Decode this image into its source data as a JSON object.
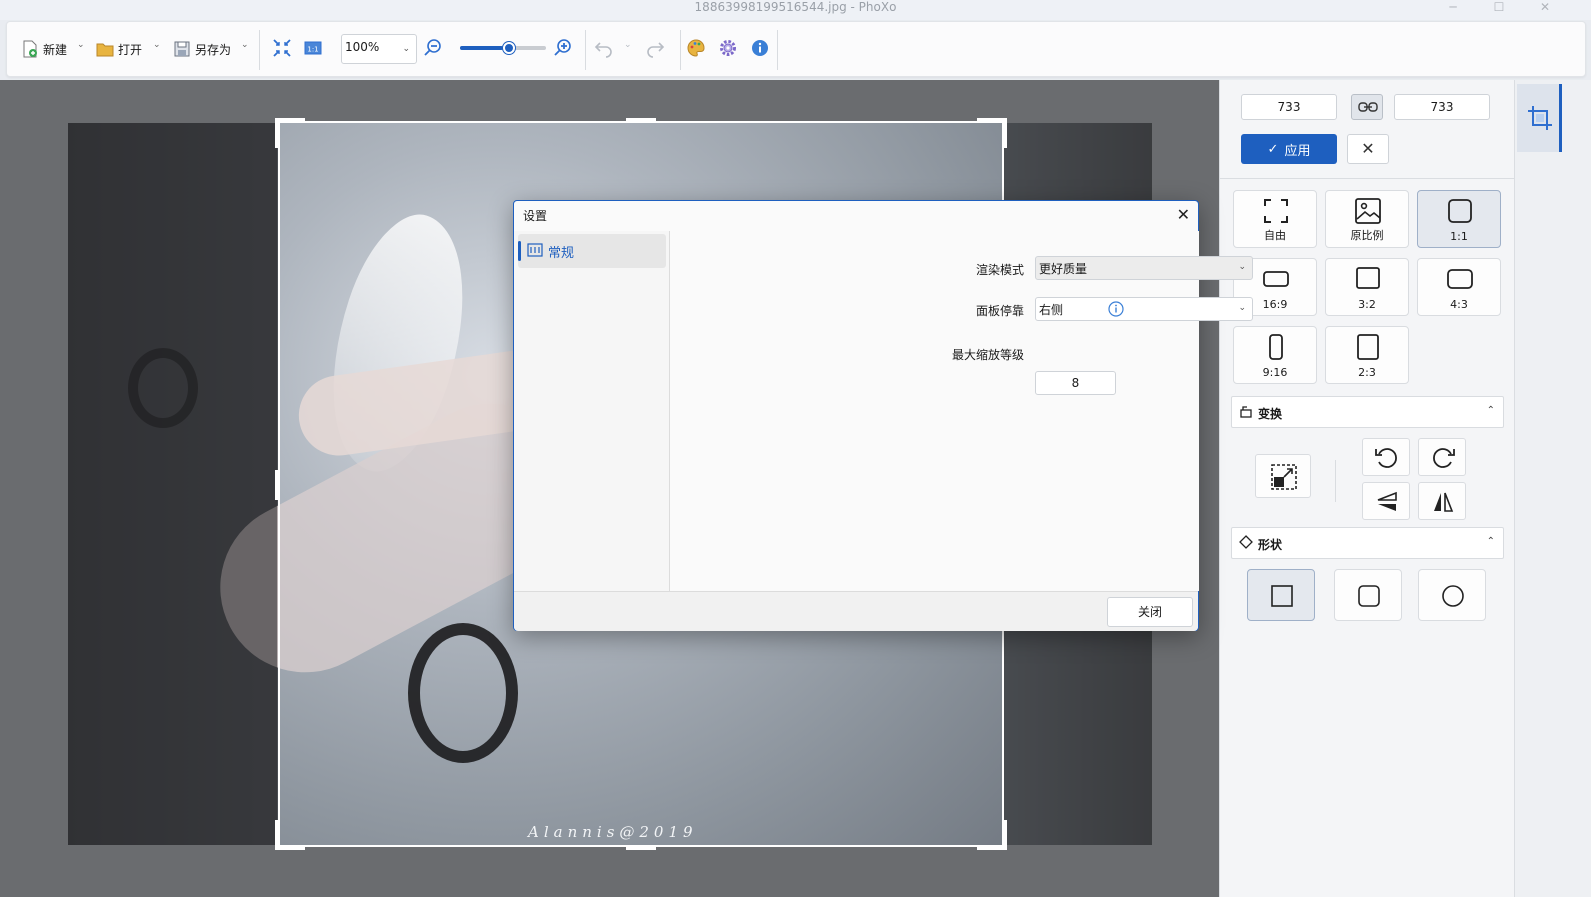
{
  "window": {
    "title": "18863998199516544.jpg - PhoXo",
    "minimize": "─",
    "maximize": "☐",
    "close": "✕"
  },
  "toolbar": {
    "new_label": "新建",
    "open_label": "打开",
    "saveas_label": "另存为",
    "zoom_value": "100%",
    "zoom_slider_fraction": 0.5
  },
  "canvas": {
    "watermark": "Alannis@2019"
  },
  "panel": {
    "width_value": "733",
    "height_value": "733",
    "apply_label": "应用",
    "ratios": [
      {
        "label": "自由"
      },
      {
        "label": "原比例"
      },
      {
        "label": "1:1"
      },
      {
        "label": "16:9"
      },
      {
        "label": "3:2"
      },
      {
        "label": "4:3"
      },
      {
        "label": "9:16"
      },
      {
        "label": "2:3"
      }
    ],
    "active_ratio": "1:1",
    "transform_header": "变换",
    "shape_header": "形状",
    "accent_color": "#1e5fbf"
  },
  "dialog": {
    "title": "设置",
    "nav_general": "常规",
    "render_mode_label": "渲染模式",
    "render_mode_value": "更好质量",
    "panel_dock_label": "面板停靠",
    "panel_dock_value": "右侧",
    "max_zoom_label": "最大缩放等级",
    "max_zoom_value": "8",
    "close_label": "关闭"
  }
}
